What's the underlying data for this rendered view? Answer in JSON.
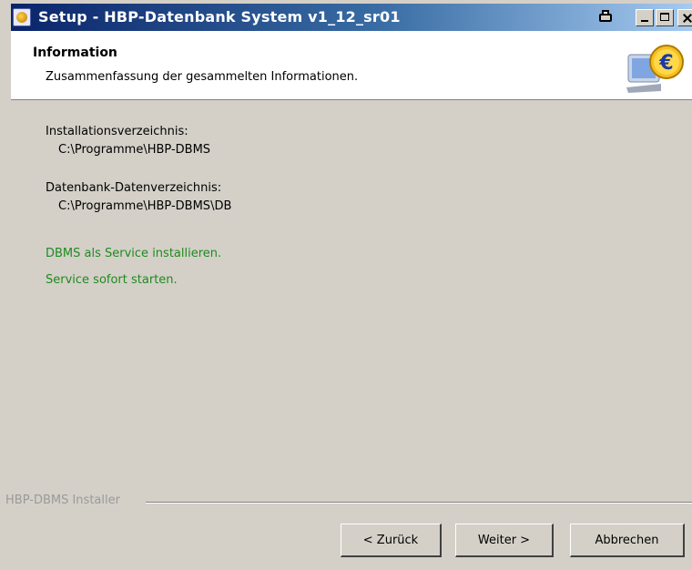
{
  "window": {
    "title": "Setup - HBP-Datenbank System v1_12_sr01"
  },
  "header": {
    "title": "Information",
    "subtitle": "Zusammenfassung der gesammelten Informationen."
  },
  "content": {
    "install_dir_label": "Installationsverzeichnis:",
    "install_dir_value": "C:\\Programme\\HBP-DBMS",
    "data_dir_label": "Datenbank-Datenverzeichnis:",
    "data_dir_value": "C:\\Programme\\HBP-DBMS\\DB",
    "service_install": "DBMS als Service installieren.",
    "service_start": "Service sofort starten."
  },
  "footer": {
    "group_label": "HBP-DBMS Installer",
    "back_label": "< Zurück",
    "next_label": "Weiter >",
    "cancel_label": "Abbrechen"
  },
  "colors": {
    "titlebar_start": "#0a246a",
    "titlebar_end": "#a6caf0",
    "dialog_bg": "#d4d0c8",
    "status_green": "#1f8a1f"
  },
  "icons": {
    "app": "setup-app-icon",
    "header": "euro-monitor-icon",
    "print": "print-icon"
  }
}
